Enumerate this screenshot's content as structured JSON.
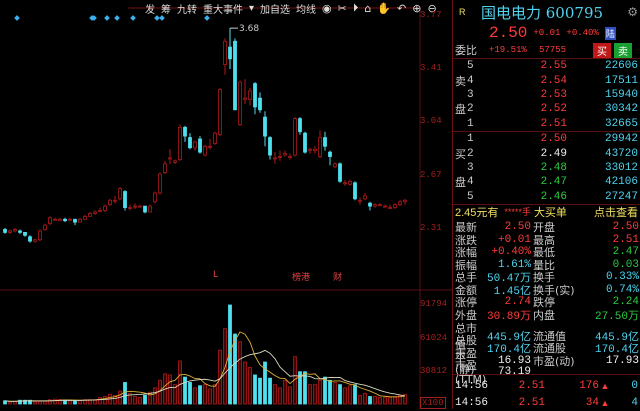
{
  "toolbar": {
    "items": [
      "发",
      "筹",
      "九转",
      "重大事件",
      "▾",
      "加自选",
      "均线"
    ],
    "icons": [
      "eye-icon",
      "scissors-icon",
      "play-icon",
      "lock-icon",
      "hand-icon",
      "undo-icon",
      "plus-circle-icon",
      "minus-circle-icon"
    ]
  },
  "price_axis": [
    "3.77",
    "3.41",
    "3.04",
    "2.67",
    "2.31"
  ],
  "volume_axis": [
    "91794",
    "61024",
    "30812",
    "X100"
  ],
  "high_label": "3.68",
  "events": [
    "L",
    "榜港",
    "财"
  ],
  "colors": {
    "up": "#b01818",
    "down": "#4fe0f0",
    "ma5": "#e0b030",
    "ma10": "#d8d8c0"
  },
  "candles": [
    [
      2.3,
      2.28,
      2.31,
      2.27
    ],
    [
      2.28,
      2.29,
      2.3,
      2.27
    ],
    [
      2.29,
      2.3,
      2.31,
      2.28
    ],
    [
      2.29,
      2.28,
      2.3,
      2.27
    ],
    [
      2.28,
      2.26,
      2.28,
      2.25
    ],
    [
      2.25,
      2.22,
      2.26,
      2.21
    ],
    [
      2.22,
      2.23,
      2.23,
      2.21
    ],
    [
      2.23,
      2.29,
      2.3,
      2.22
    ],
    [
      2.3,
      2.33,
      2.34,
      2.29
    ],
    [
      2.34,
      2.38,
      2.39,
      2.33
    ],
    [
      2.37,
      2.37,
      2.38,
      2.36
    ],
    [
      2.36,
      2.37,
      2.38,
      2.36
    ],
    [
      2.37,
      2.36,
      2.38,
      2.35
    ],
    [
      2.37,
      2.37,
      2.38,
      2.36
    ],
    [
      2.37,
      2.35,
      2.37,
      2.33
    ],
    [
      2.35,
      2.37,
      2.38,
      2.35
    ],
    [
      2.37,
      2.39,
      2.4,
      2.37
    ],
    [
      2.39,
      2.41,
      2.42,
      2.39
    ],
    [
      2.41,
      2.42,
      2.43,
      2.4
    ],
    [
      2.43,
      2.43,
      2.45,
      2.42
    ],
    [
      2.43,
      2.46,
      2.47,
      2.42
    ],
    [
      2.47,
      2.5,
      2.51,
      2.46
    ],
    [
      2.5,
      2.5,
      2.53,
      2.48
    ],
    [
      2.51,
      2.58,
      2.59,
      2.5
    ],
    [
      2.56,
      2.45,
      2.57,
      2.43
    ],
    [
      2.45,
      2.45,
      2.47,
      2.43
    ],
    [
      2.46,
      2.46,
      2.48,
      2.44
    ],
    [
      2.46,
      2.46,
      2.47,
      2.45
    ],
    [
      2.46,
      2.42,
      2.46,
      2.41
    ],
    [
      2.42,
      2.46,
      2.47,
      2.42
    ],
    [
      2.49,
      2.55,
      2.56,
      2.48
    ],
    [
      2.55,
      2.68,
      2.69,
      2.54
    ],
    [
      2.69,
      2.75,
      2.77,
      2.68
    ],
    [
      2.79,
      2.79,
      2.85,
      2.75
    ],
    [
      2.76,
      2.77,
      2.78,
      2.75
    ],
    [
      2.78,
      3.0,
      3.02,
      2.77
    ],
    [
      3.0,
      2.94,
      3.01,
      2.9
    ],
    [
      2.93,
      2.86,
      2.96,
      2.85
    ],
    [
      2.86,
      2.9,
      2.91,
      2.84
    ],
    [
      2.92,
      2.83,
      2.94,
      2.82
    ],
    [
      2.81,
      2.87,
      2.88,
      2.8
    ],
    [
      2.87,
      2.87,
      2.92,
      2.85
    ],
    [
      2.89,
      2.96,
      2.97,
      2.88
    ],
    [
      2.95,
      3.26,
      3.27,
      2.94
    ],
    [
      3.43,
      3.59,
      3.61,
      3.36
    ],
    [
      3.55,
      3.47,
      3.68,
      3.4
    ],
    [
      3.59,
      3.12,
      3.61,
      3.12
    ],
    [
      3.02,
      3.31,
      3.32,
      3.01
    ],
    [
      3.2,
      3.2,
      3.33,
      3.16
    ],
    [
      3.19,
      3.25,
      3.27,
      3.15
    ],
    [
      3.3,
      3.14,
      3.31,
      3.09
    ],
    [
      3.2,
      3.12,
      3.24,
      3.1
    ],
    [
      3.07,
      2.94,
      3.11,
      2.87
    ],
    [
      2.93,
      2.81,
      2.94,
      2.78
    ],
    [
      2.79,
      2.79,
      2.83,
      2.75
    ],
    [
      2.8,
      2.8,
      2.84,
      2.77
    ],
    [
      2.81,
      2.82,
      2.84,
      2.8
    ],
    [
      2.8,
      2.8,
      2.82,
      2.78
    ],
    [
      2.81,
      3.06,
      3.07,
      2.8
    ],
    [
      3.06,
      2.97,
      3.07,
      2.95
    ],
    [
      2.96,
      2.83,
      2.97,
      2.82
    ],
    [
      2.84,
      2.85,
      2.86,
      2.82
    ],
    [
      2.84,
      2.85,
      2.87,
      2.82
    ],
    [
      2.8,
      2.93,
      2.98,
      2.79
    ],
    [
      2.93,
      2.87,
      2.97,
      2.84
    ],
    [
      2.83,
      2.8,
      2.84,
      2.74
    ],
    [
      2.73,
      2.75,
      2.76,
      2.72
    ],
    [
      2.75,
      2.63,
      2.76,
      2.62
    ],
    [
      2.62,
      2.62,
      2.64,
      2.6
    ],
    [
      2.61,
      2.63,
      2.64,
      2.6
    ],
    [
      2.62,
      2.51,
      2.63,
      2.5
    ],
    [
      2.5,
      2.5,
      2.52,
      2.47
    ],
    [
      2.51,
      2.53,
      2.55,
      2.5
    ],
    [
      2.48,
      2.46,
      2.49,
      2.43
    ],
    [
      2.46,
      2.47,
      2.48,
      2.45
    ],
    [
      2.47,
      2.47,
      2.48,
      2.46
    ],
    [
      2.46,
      2.46,
      2.47,
      2.45
    ],
    [
      2.45,
      2.45,
      2.47,
      2.44
    ],
    [
      2.45,
      2.47,
      2.48,
      2.44
    ],
    [
      2.47,
      2.49,
      2.5,
      2.46
    ],
    [
      2.49,
      2.5,
      2.51,
      2.47
    ]
  ],
  "volumes": [
    3000,
    2000,
    2500,
    3500,
    3500,
    3500,
    2000,
    2500,
    3000,
    4000,
    4500,
    4000,
    3500,
    3000,
    3500,
    3500,
    4000,
    4000,
    4000,
    6000,
    7000,
    9000,
    8000,
    12000,
    20000,
    10000,
    7000,
    6000,
    8000,
    11000,
    15000,
    22000,
    28000,
    27000,
    18000,
    40000,
    25000,
    20000,
    15000,
    17000,
    18000,
    14000,
    18000,
    50000,
    70000,
    92000,
    65000,
    58000,
    39000,
    34000,
    27000,
    24000,
    39000,
    24000,
    18000,
    15000,
    22000,
    16000,
    44000,
    30000,
    30000,
    18000,
    18000,
    22000,
    25000,
    22000,
    20000,
    18000,
    15000,
    17000,
    18000,
    8000,
    10000,
    7000,
    7000,
    6000,
    6000,
    7000,
    7000,
    8000,
    9000
  ],
  "quote": {
    "badge": "R",
    "title": "国电电力 600795",
    "price": "2.50",
    "change": "+0.01",
    "pct": "+0.40%",
    "market": "陆",
    "wb_label": "委比",
    "wb_pct": "+19.51%",
    "wb_diff": "57755",
    "buy_btn": "买",
    "sell_btn": "卖"
  },
  "asks": [
    {
      "side": "",
      "lvl": "5",
      "price": "2.55",
      "vol": "22606"
    },
    {
      "side": "卖",
      "lvl": "4",
      "price": "2.54",
      "vol": "17511"
    },
    {
      "side": "",
      "lvl": "3",
      "price": "2.53",
      "vol": "15940"
    },
    {
      "side": "盘",
      "lvl": "2",
      "price": "2.52",
      "vol": "30342"
    },
    {
      "side": "",
      "lvl": "1",
      "price": "2.51",
      "vol": "32665"
    }
  ],
  "bids": [
    {
      "side": "",
      "lvl": "1",
      "price": "2.50",
      "vol": "29942"
    },
    {
      "side": "买",
      "lvl": "2",
      "price": "2.49",
      "vol": "43720"
    },
    {
      "side": "",
      "lvl": "3",
      "price": "2.48",
      "vol": "33012"
    },
    {
      "side": "盘",
      "lvl": "4",
      "price": "2.47",
      "vol": "42106"
    },
    {
      "side": "",
      "lvl": "5",
      "price": "2.46",
      "vol": "27247"
    }
  ],
  "bigorder": {
    "price": "2.45元有",
    "qty": "*****手",
    "label": "大买单",
    "link": "点击查看"
  },
  "stats": [
    [
      "最新",
      "2.50",
      "开盘",
      "2.50"
    ],
    [
      "涨跌",
      "+0.01",
      "最高",
      "2.51"
    ],
    [
      "涨幅",
      "+0.40%",
      "最低",
      "2.47"
    ],
    [
      "振幅",
      "1.61%",
      "量比",
      "0.03"
    ],
    [
      "总手",
      "50.47万",
      "换手",
      "0.33%"
    ],
    [
      "金额",
      "1.45亿",
      "换手(实)",
      "0.74%"
    ],
    [
      "涨停",
      "2.74",
      "跌停",
      "2.24"
    ],
    [
      "外盘",
      "30.89万",
      "内盘",
      "27.50万"
    ],
    [
      "总市值",
      "445.9亿",
      "流通值",
      "445.9亿"
    ],
    [
      "总股本",
      "170.4亿",
      "流通股",
      "170.4亿"
    ],
    [
      "市盈(静)",
      "16.93",
      "市盈(动)",
      "17.93"
    ],
    [
      "市盈(TTM)",
      "73.19",
      "",
      ""
    ]
  ],
  "ticks": [
    {
      "time": "14:56",
      "price": "2.51",
      "vol": "176",
      "flag": "0"
    },
    {
      "time": "14:56",
      "price": "2.51",
      "vol": "34",
      "flag": "4"
    }
  ]
}
